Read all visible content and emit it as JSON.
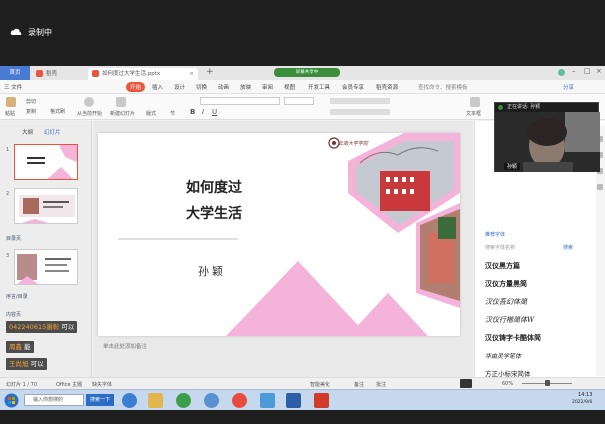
{
  "recorder": {
    "label": "录制中",
    "icon": "cloud-icon"
  },
  "tabs": [
    {
      "label": "首页"
    },
    {
      "label": "稻壳"
    },
    {
      "label": "如何度过大学生活.pptx"
    }
  ],
  "share_pill": "屏幕共享中",
  "menu": {
    "file": "三 文件",
    "items": [
      "开始",
      "插入",
      "设计",
      "切换",
      "动画",
      "放映",
      "审阅",
      "视图",
      "开发工具",
      "会员专享",
      "稻壳资源"
    ],
    "search": "查找命令、搜索模板",
    "share": "分享"
  },
  "ribbon": {
    "paste": "粘贴",
    "cut": "剪切",
    "copy": "复制",
    "format_painter": "格式刷",
    "from_current": "从当前开始",
    "new_slide": "新建幻灯片",
    "layout": "版式",
    "section": "节",
    "textbox": "文本框",
    "arrange": "排列"
  },
  "left_pane": {
    "tab_outline": "大纲",
    "tab_slides": "幻灯片",
    "sections": [
      "目录页",
      "序言/目录",
      "内容页"
    ],
    "slide_numbers": [
      "1",
      "2",
      "3"
    ]
  },
  "slide": {
    "logo_text": "云南大学学院",
    "title_line1": "如何度过",
    "title_line2": "大学生活",
    "author": "孙颖"
  },
  "notes_placeholder": "单击此处添加备注",
  "video": {
    "header": "正在讲话: 孙颖",
    "name": "孙颖"
  },
  "right_pane": {
    "section_label": "推荐字体",
    "search_placeholder": "搜索字体名称",
    "search_btn": "搜索",
    "fonts": [
      "汉仪黑方篇",
      "汉仪方量黑简",
      "汉仪吾幻体简",
      "汉仪行楷简体W",
      "汉仪铸字卡酷体简",
      "华由灵学笔体",
      "方正小标宋简体"
    ],
    "more": "稿文字效果"
  },
  "chat": [
    {
      "name": "0422406​15谢彰",
      "msg": "可以"
    },
    {
      "name": "周鑫",
      "msg": "能"
    },
    {
      "name": "王尚旭",
      "msg": "可以"
    }
  ],
  "status": {
    "slide_count": "幻灯片 1 / 70",
    "theme": "Office 主题",
    "missing_font": "缺失字体",
    "smart_beautify": "智能美化",
    "notes": "备注",
    "comments": "批注",
    "zoom": "60%"
  },
  "taskbar": {
    "ime": "输入你想搜的",
    "search_btn": "搜索一下",
    "time": "14:13",
    "date": "2022/9/6"
  },
  "colors": {
    "accent": "#e8553e",
    "pink": "#f4b3d9",
    "tab_blue": "#4a7bd4",
    "chat_name": "#f2a33a"
  }
}
